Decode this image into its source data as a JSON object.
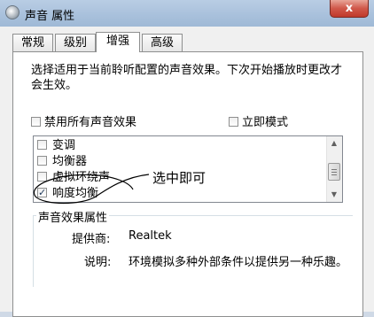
{
  "window": {
    "title": "声音 属性",
    "close_label": "x"
  },
  "tabs": [
    {
      "label": "常规"
    },
    {
      "label": "级别"
    },
    {
      "label": "增强",
      "active": true
    },
    {
      "label": "高级"
    }
  ],
  "panel": {
    "description": "选择适用于当前聆听配置的声音效果。下次开始播放时更改才会生效。",
    "disable_all_label": "禁用所有声音效果",
    "disable_all_checked": false,
    "immediate_mode_label": "立即模式",
    "immediate_mode_checked": false
  },
  "effects": [
    {
      "label": "变调",
      "checked": false
    },
    {
      "label": "均衡器",
      "checked": false
    },
    {
      "label": "虚拟环绕声",
      "checked": false
    },
    {
      "label": "响度均衡",
      "checked": true
    }
  ],
  "properties": {
    "group_title": "声音效果属性",
    "provider_label": "提供商:",
    "provider_value": "Realtek",
    "description_label": "说明:",
    "description_value": "环境模拟多种外部条件以提供另一种乐趣。"
  },
  "annotation": {
    "text": "选中即可"
  }
}
